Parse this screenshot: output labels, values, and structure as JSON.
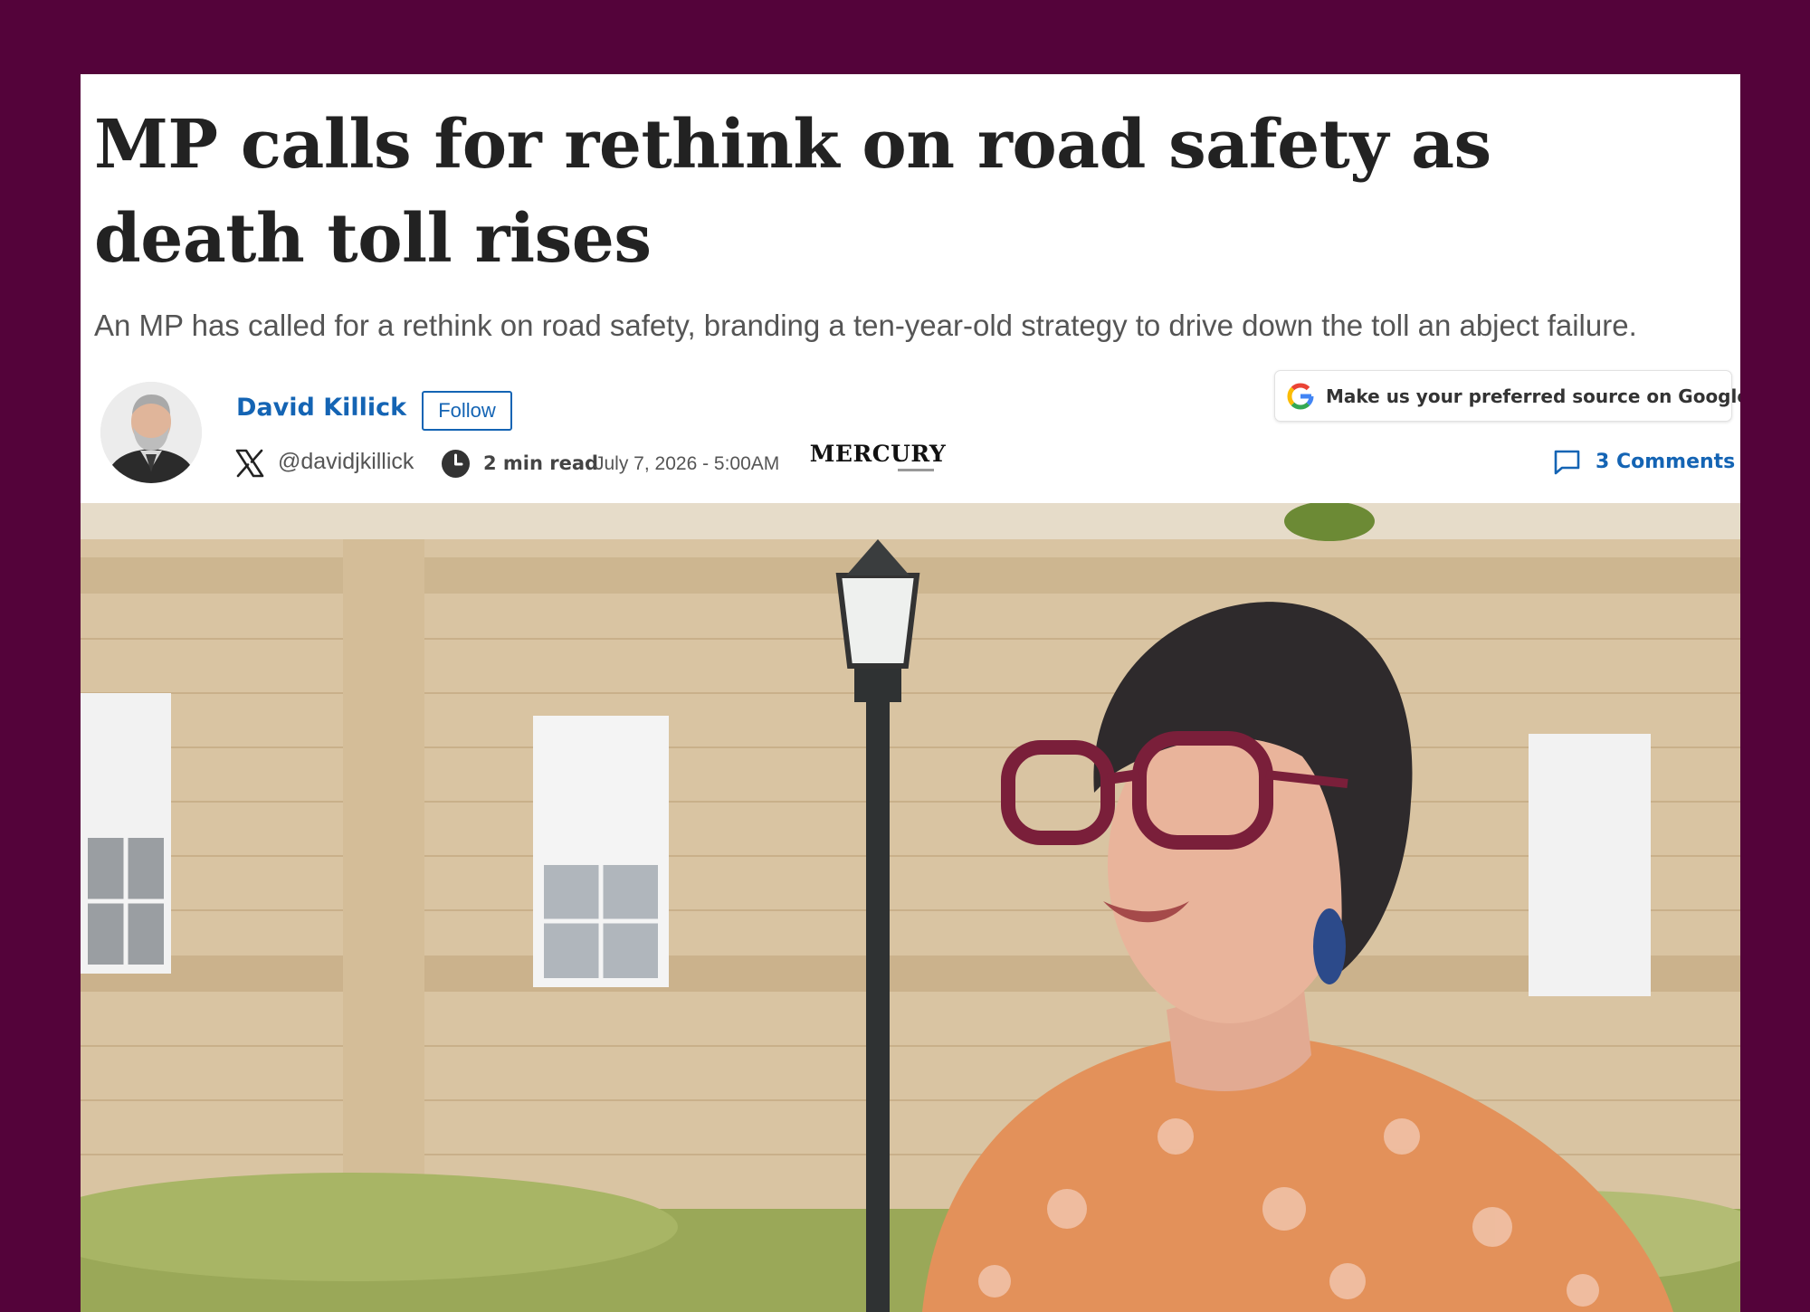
{
  "article": {
    "headline": "MP calls for rethink on road safety as death toll rises",
    "standfirst": "An MP has called for a rethink on road safety, branding a ten-year-old strategy to drive down the toll an abject failure."
  },
  "byline": {
    "author_name": "David Killick",
    "follow_label": "Follow",
    "x_handle": "@davidjkillick",
    "read_time": "2 min read",
    "date": "July 7, 2026 - 5:00AM",
    "masthead": "MERCURY"
  },
  "actions": {
    "google_source_label": "Make us your preferred source on Google",
    "comments_label": "3 Comments"
  },
  "colors": {
    "frame_background": "#54033a",
    "link_blue": "#1464b4",
    "headline": "#222222"
  },
  "icons": {
    "x": "x-logo-icon",
    "clock": "clock-icon",
    "google": "google-g-icon",
    "comments": "comment-bubble-icon"
  }
}
